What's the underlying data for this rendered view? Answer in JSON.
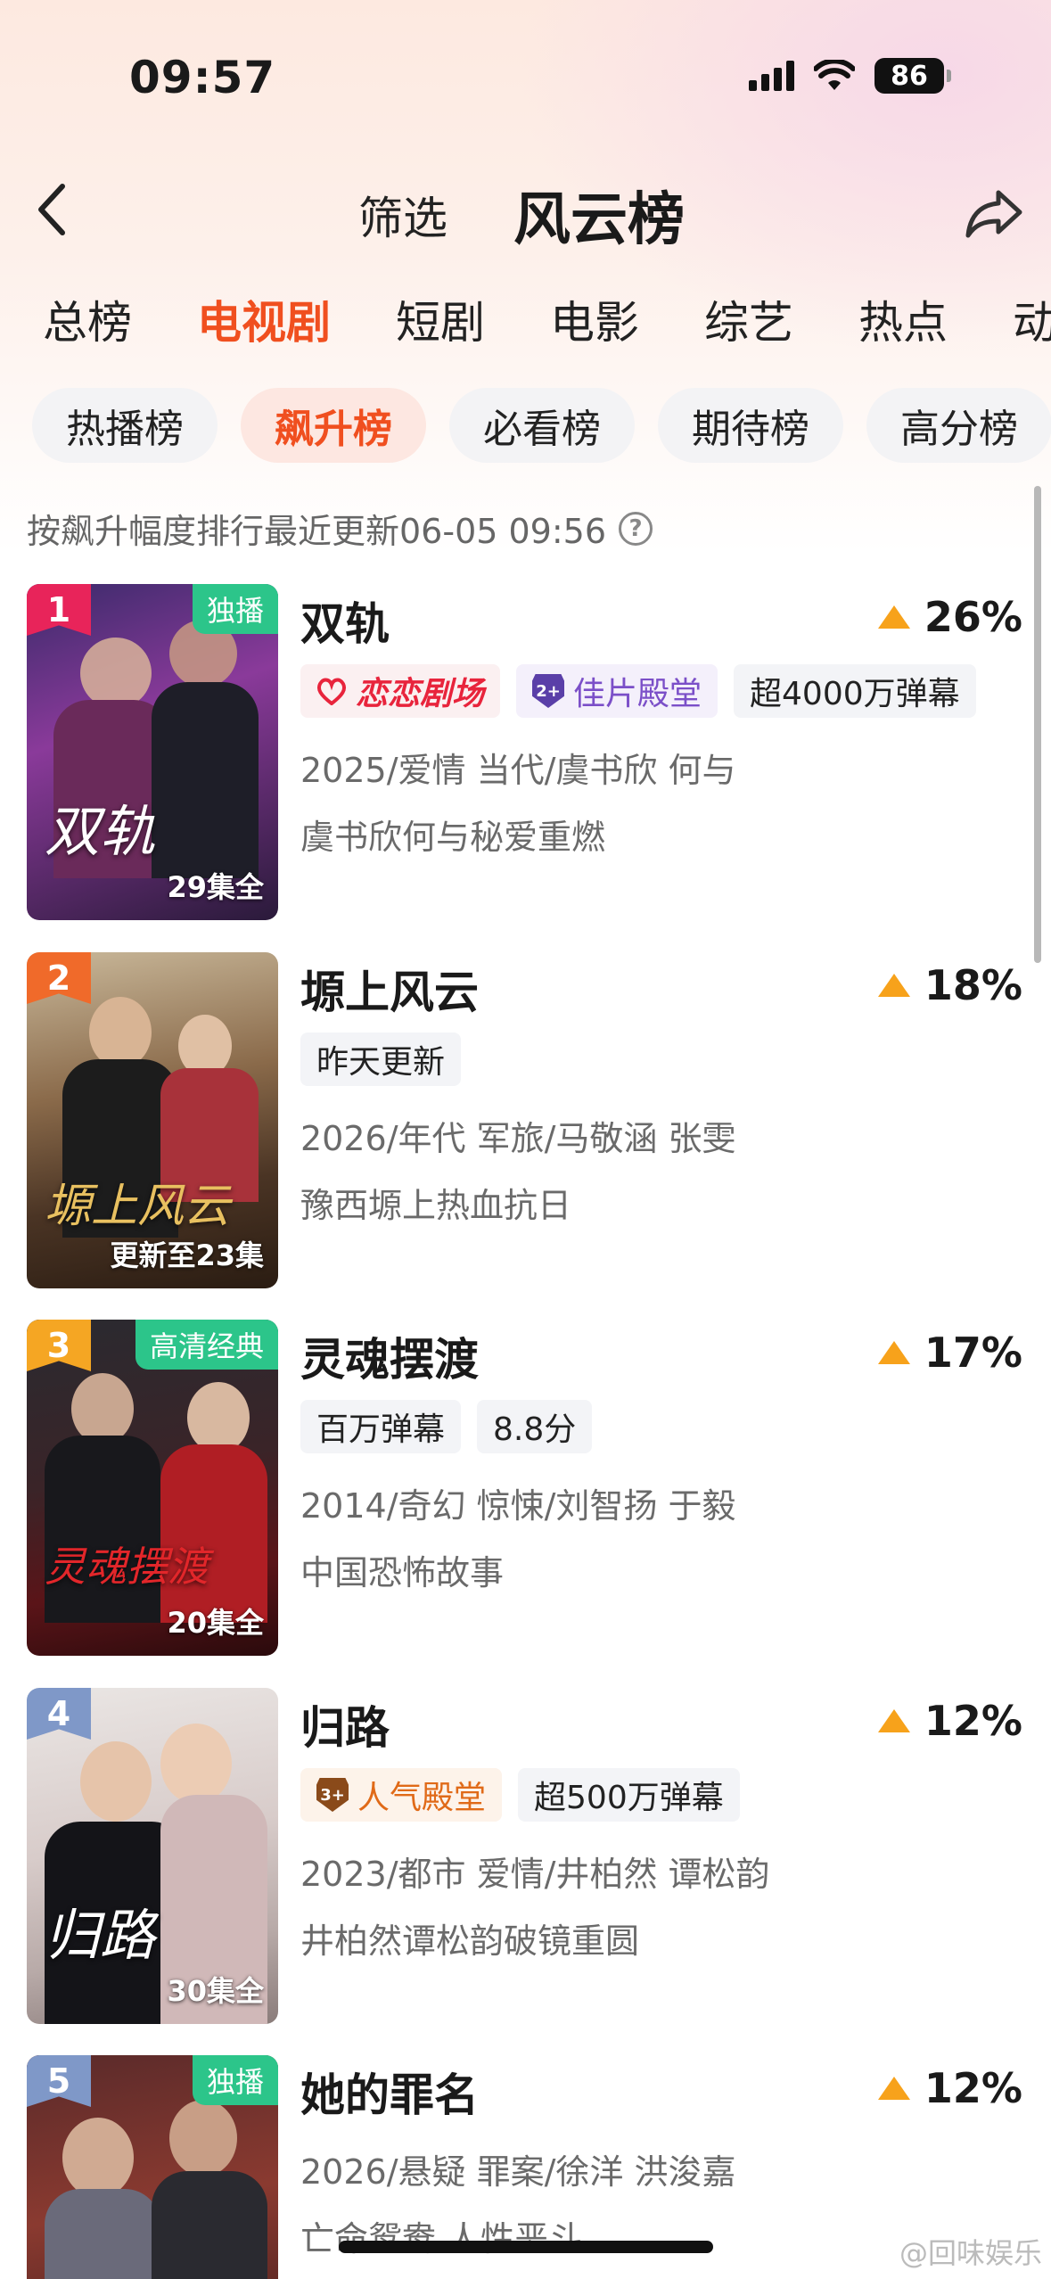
{
  "status_bar": {
    "time": "09:57",
    "battery": "86"
  },
  "nav": {
    "filter": "筛选",
    "title": "风云榜"
  },
  "category_tabs": [
    "总榜",
    "电视剧",
    "短剧",
    "电影",
    "综艺",
    "热点",
    "动"
  ],
  "active_category": "电视剧",
  "sub_tabs": [
    "热播榜",
    "飙升榜",
    "必看榜",
    "期待榜",
    "高分榜"
  ],
  "active_sub_tab": "飙升榜",
  "sort_hint": "按飙升幅度排行最近更新06-05 09:56",
  "items": [
    {
      "rank": "1",
      "title": "双轨",
      "trend": "26%",
      "poster_tag": "独播",
      "poster_eps": "29集全",
      "poster_art": "双轨",
      "badges": [
        "恋恋剧场",
        "佳片殿堂",
        "超4000万弹幕"
      ],
      "meta1": "2025/爱情 当代/虞书欣 何与",
      "meta2": "虞书欣何与秘爱重燃"
    },
    {
      "rank": "2",
      "title": "塬上风云",
      "trend": "18%",
      "poster_tag": "",
      "poster_eps": "更新至23集",
      "poster_art": "塬上风云",
      "badges": [
        "昨天更新"
      ],
      "meta1": "2026/年代 军旅/马敬涵 张雯",
      "meta2": "豫西塬上热血抗日"
    },
    {
      "rank": "3",
      "title": "灵魂摆渡",
      "trend": "17%",
      "poster_tag": "高清经典",
      "poster_eps": "20集全",
      "poster_art": "灵魂摆渡",
      "badges": [
        "百万弹幕",
        "8.8分"
      ],
      "meta1": "2014/奇幻 惊悚/刘智扬 于毅",
      "meta2": "中国恐怖故事"
    },
    {
      "rank": "4",
      "title": "归路",
      "trend": "12%",
      "poster_tag": "",
      "poster_eps": "30集全",
      "poster_art": "归路",
      "badges": [
        "人气殿堂",
        "超500万弹幕"
      ],
      "meta1": "2023/都市 爱情/井柏然 谭松韵",
      "meta2": "井柏然谭松韵破镜重圆"
    },
    {
      "rank": "5",
      "title": "她的罪名",
      "trend": "12%",
      "poster_tag": "独播",
      "poster_eps": "",
      "poster_art": "",
      "badges": [],
      "meta1": "2026/悬疑 罪案/徐洋 洪浚嘉",
      "meta2": "亡命鸳鸯 人性恶斗"
    }
  ],
  "watermark": "@回味娱乐",
  "colors": {
    "accent": "#f04f1f",
    "trend": "#f7a21b",
    "exclusive_tag": "#2cc58a",
    "rank1": "#e8245a",
    "rank2": "#f06a2a",
    "rank3": "#f5a623",
    "rank_other": "#7f98c8"
  }
}
